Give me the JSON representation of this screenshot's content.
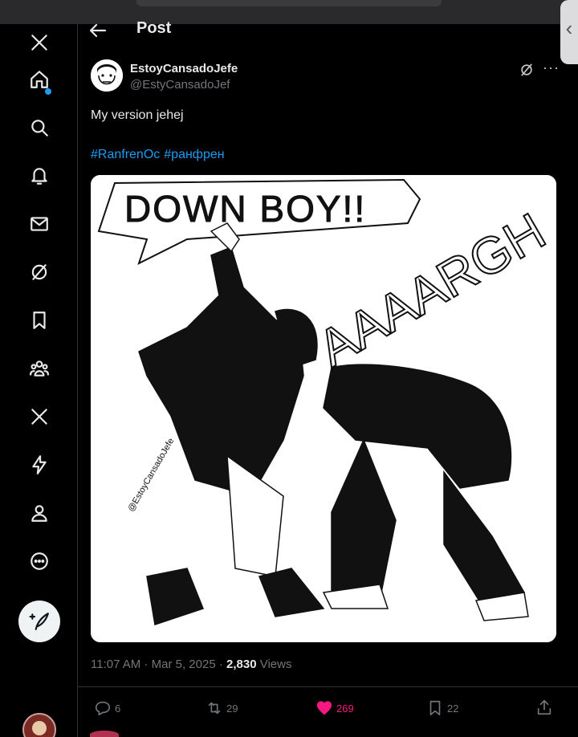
{
  "header": {
    "title": "Post"
  },
  "sidebar": {
    "icons": [
      "x-logo-icon",
      "home-icon",
      "search-icon",
      "bell-icon",
      "mail-icon",
      "grok-icon",
      "bookmark-icon",
      "communities-icon",
      "premium-x-icon",
      "lightning-icon",
      "profile-icon",
      "more-circle-icon"
    ],
    "compose": "compose-post-icon"
  },
  "post": {
    "author_name": "EstoyCansadoJefe",
    "author_handle": "@EstyCansadoJef",
    "text": "My version jehej",
    "hashtags": [
      "#RanfrenOc",
      "#ранфрен"
    ],
    "image_caption": "DOWN BOY!!",
    "image_yell": "AAAARGH",
    "image_signature": "@EstoyCansadoJefe",
    "time": "11:07 AM",
    "separator": "·",
    "date": "Mar 5, 2025",
    "views_count": "2,830",
    "views_label": "Views"
  },
  "actions": {
    "replies": "6",
    "reposts": "29",
    "likes": "269",
    "bookmarks": "22"
  },
  "colors": {
    "accent": "#1d9bf0",
    "like": "#f91880",
    "background": "#000000",
    "muted": "#71767b"
  }
}
